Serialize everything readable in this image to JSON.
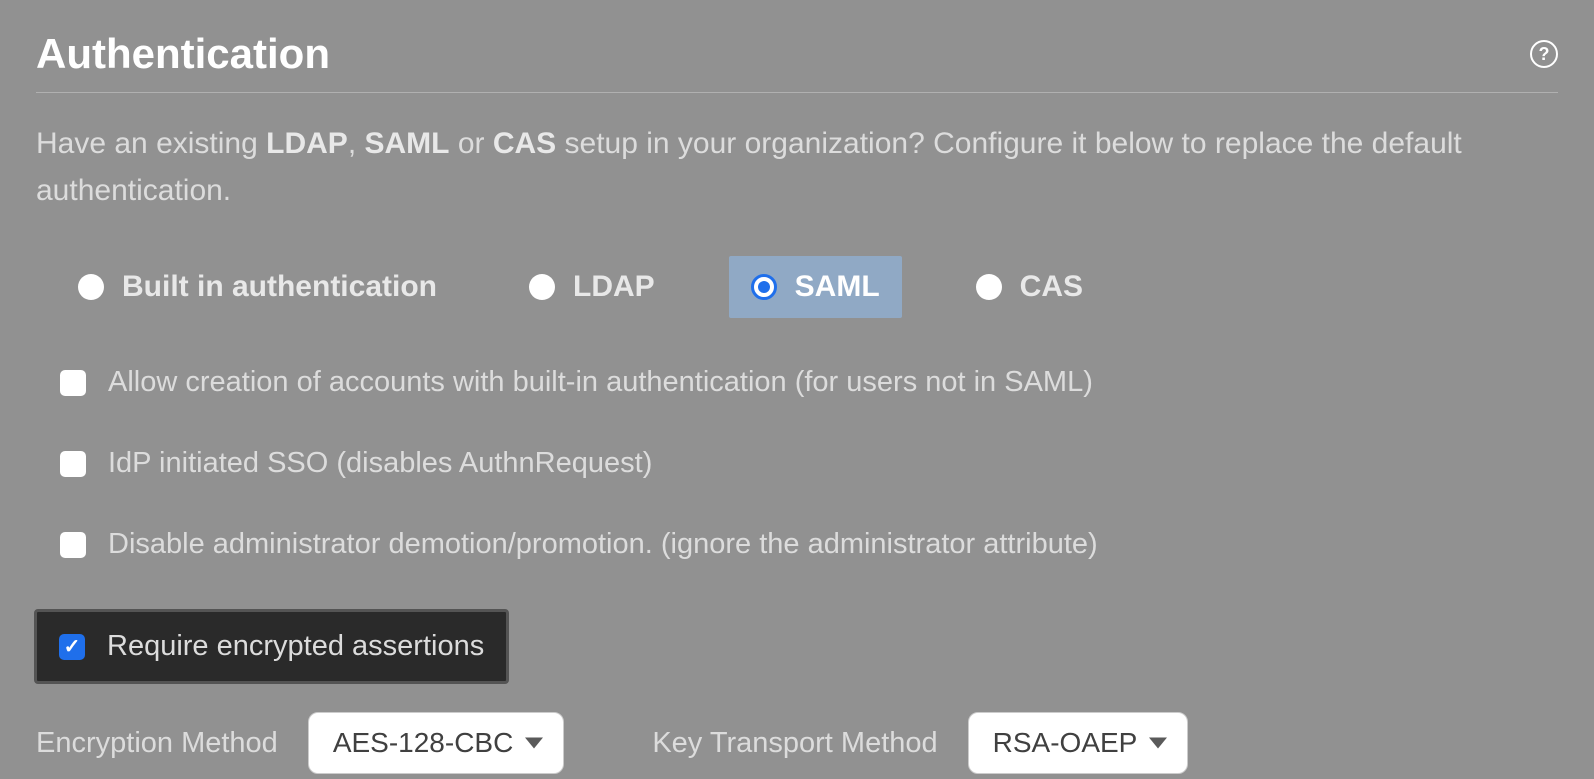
{
  "header": {
    "title": "Authentication"
  },
  "description": {
    "prefix": "Have an existing ",
    "ldap": "LDAP",
    "sep1": ", ",
    "saml": "SAML",
    "sep2": " or ",
    "cas": "CAS",
    "suffix": " setup in your organization? Configure it below to replace the default authentication."
  },
  "auth_methods": {
    "builtin": "Built in authentication",
    "ldap": "LDAP",
    "saml": "SAML",
    "cas": "CAS"
  },
  "checkboxes": {
    "allow_creation": {
      "main": "Allow creation of accounts with built-in authentication ",
      "hint": "(for users not in SAML)"
    },
    "idp_sso": "IdP initiated SSO (disables AuthnRequest)",
    "disable_admin": "Disable administrator demotion/promotion. (ignore the administrator attribute)",
    "require_encrypted": "Require encrypted assertions"
  },
  "selects": {
    "enc_method_label": "Encryption Method",
    "enc_method_value": "AES-128-CBC",
    "key_transport_label": "Key Transport Method",
    "key_transport_value": "RSA-OAEP"
  }
}
